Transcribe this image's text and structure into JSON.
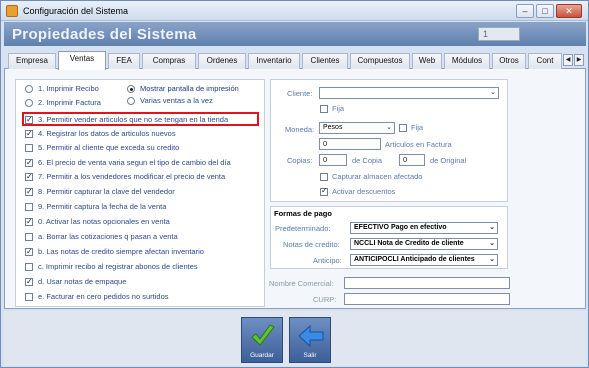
{
  "window": {
    "title": "Configuración del Sistema",
    "minimize": "–",
    "maximize": "□",
    "close": "✕"
  },
  "header": {
    "title": "Propiedades del Sistema",
    "field_value": "1"
  },
  "tabs": [
    "Empresa",
    "Ventas",
    "FEA",
    "Compras",
    "Ordenes",
    "Inventario",
    "Clientes",
    "Compuestos",
    "Web",
    "Módulos",
    "Otros",
    "Cont"
  ],
  "active_tab": "Ventas",
  "radios": [
    {
      "label": "1. Imprimir Recibo",
      "checked": false
    },
    {
      "label": "2. Imprimir Factura",
      "checked": false
    },
    {
      "label": "Mostrar pantalla de impresión",
      "checked": true
    },
    {
      "label": "Varias ventas a la vez",
      "checked": false
    }
  ],
  "options": [
    {
      "label": "3. Permitir vender articulos que no se tengan en la tienda",
      "checked": true
    },
    {
      "label": "4. Registrar los datos de articulos nuevos",
      "checked": true
    },
    {
      "label": "5. Permitir al cliente que exceda su credito",
      "checked": false
    },
    {
      "label": "6. El precio de venta varia segun el tipo de cambio del día",
      "checked": true
    },
    {
      "label": "7. Permitir a los vendedores modificar el precio de venta",
      "checked": true
    },
    {
      "label": "8. Permitir capturar la clave del vendedor",
      "checked": true
    },
    {
      "label": "9. Permitir captura la fecha de la venta",
      "checked": false
    },
    {
      "label": "0. Activar las notas opcionales en venta",
      "checked": true
    },
    {
      "label": "a. Borrar las cotizaciones q pasan a venta",
      "checked": false
    },
    {
      "label": "b. Las notas de credito siempre afectan inventario",
      "checked": true
    },
    {
      "label": "c. Imprimir recibo al registrar abonos de clientes",
      "checked": false
    },
    {
      "label": "d. Usar notas de empaque",
      "checked": true
    },
    {
      "label": "e. Facturar en cero pedidos no surtidos",
      "checked": false
    }
  ],
  "right": {
    "cliente_label": "Cliente:",
    "cliente_value": "",
    "fija_label": "Fija",
    "moneda_label": "Moneda:",
    "moneda_value": "Pesos",
    "fija2_label": "Fija",
    "articulos_value": "0",
    "articulos_label": "Articulos en Factura",
    "copias_label": "Copias:",
    "copias_value": "0",
    "de_copia_label": "de Copia",
    "original_value": "0",
    "de_original_label": "de Original",
    "capturar_label": "Capturar almacen afectado",
    "activar_label": "Activar descuentos"
  },
  "pago": {
    "title": "Formas de pago",
    "predeterminado_label": "Predeterminado:",
    "predeterminado_value": "EFECTIVO Pago en efectivo",
    "notas_label": "Notas de credito:",
    "notas_value": "NCCLI Nota de Credito de cliente",
    "anticipo_label": "Anticipo:",
    "anticipo_value": "ANTICIPOCLI Anticipado de clientes"
  },
  "extra": {
    "nombre_label": "Nombre Comercial:",
    "curp_label": "CURP:"
  },
  "buttons": {
    "guardar": "Guardar",
    "salir": "Salir"
  }
}
